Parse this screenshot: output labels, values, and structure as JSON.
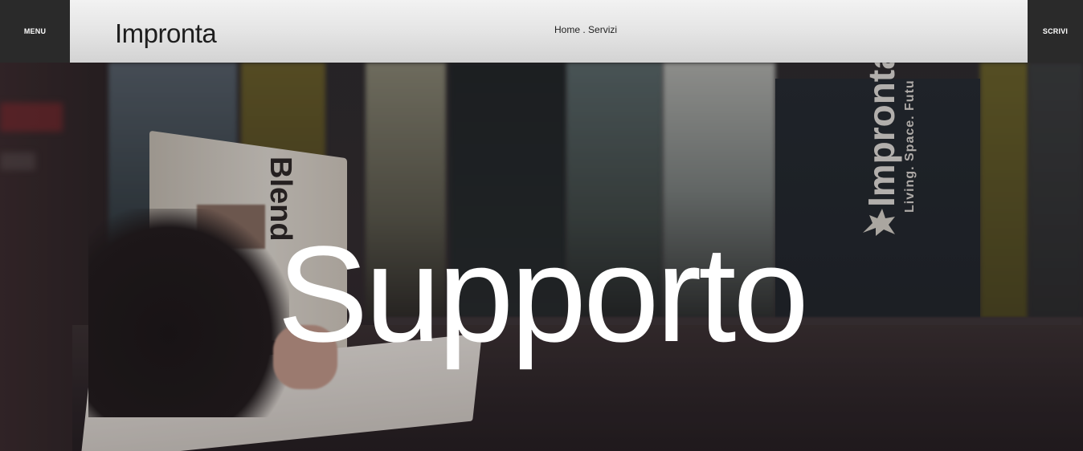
{
  "header": {
    "menu_label": "MENU",
    "logo_text": "Impronta",
    "breadcrumb": {
      "home": "Home",
      "separator": " . ",
      "current": "Servizi"
    },
    "write_label": "SCRIVI"
  },
  "hero": {
    "title": "Supporto",
    "background": {
      "magazine_text": "Blend",
      "box_brand_text": "Impronta",
      "box_tagline": "Living. Space. Futu"
    }
  },
  "colors": {
    "side_button_bg": "#2a2a2a",
    "header_bg": "#e6e6e6",
    "title_color": "#ffffff"
  },
  "icons": {
    "box_logo": "figure-icon"
  }
}
